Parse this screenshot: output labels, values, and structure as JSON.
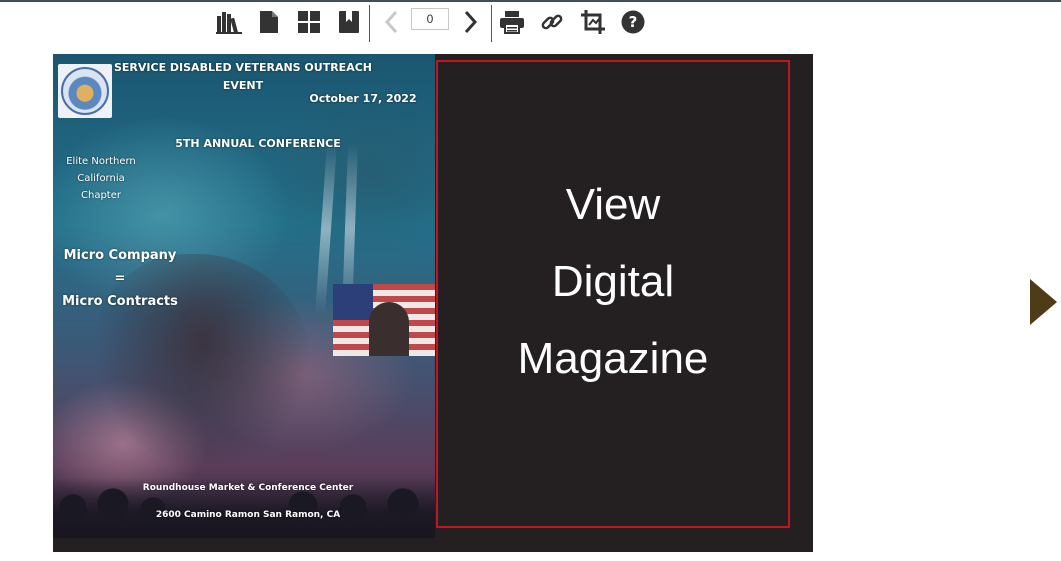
{
  "toolbar": {
    "icons": {
      "library": "library-icon",
      "single_page": "single-page-icon",
      "thumbnails": "thumbnails-icon",
      "bookmark": "bookmark-icon",
      "prev": "chevron-left-icon",
      "next": "chevron-right-icon",
      "print": "print-icon",
      "link": "link-icon",
      "crop": "crop-icon",
      "help": "help-icon"
    },
    "page_number": "0"
  },
  "cover": {
    "event_title": "SERVICE DISABLED VETERANS OUTREACH EVENT",
    "date": "October 17, 2022",
    "conference": "5TH ANNUAL CONFERENCE",
    "chapter": [
      "Elite Northern",
      "California",
      "Chapter"
    ],
    "slogan": [
      "Micro Company",
      "=",
      "Micro Contracts"
    ],
    "venue": "Roundhouse Market & Conference Center",
    "address": "2600 Camino Ramon San Ramon, CA"
  },
  "promo": {
    "line1": "View",
    "line2": "Digital",
    "line3": "Magazine",
    "border_color": "#c0161f"
  },
  "colors": {
    "stage_bg": "#241f21",
    "next_arrow": "#4f3b16"
  }
}
